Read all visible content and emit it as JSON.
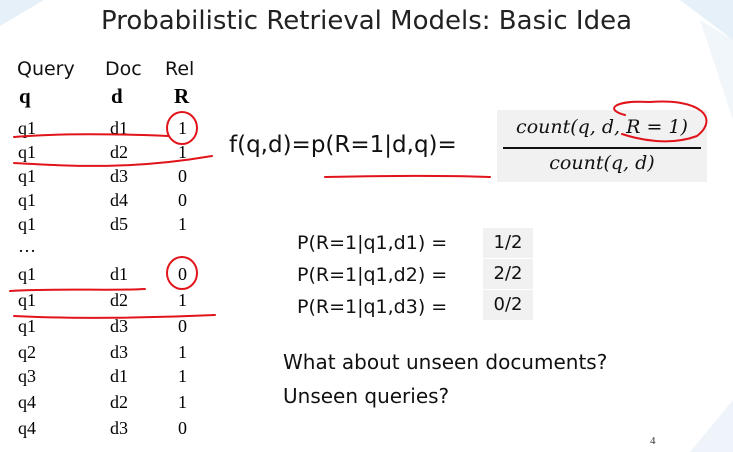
{
  "slide": {
    "title": "Probabilistic Retrieval Models: Basic Idea",
    "table": {
      "headers": [
        "Query",
        "Doc",
        "Rel"
      ],
      "symbols": [
        "q",
        "d",
        "R"
      ],
      "rows": [
        [
          "q1",
          "d1",
          "1"
        ],
        [
          "q1",
          "d2",
          "1"
        ],
        [
          "q1",
          "d3",
          "0"
        ],
        [
          "q1",
          "d4",
          "0"
        ],
        [
          "q1",
          "d5",
          "1"
        ],
        [
          "…",
          "",
          ""
        ],
        [
          "q1",
          "d1",
          "0"
        ],
        [
          "q1",
          "d2",
          "1"
        ],
        [
          "q1",
          "d3",
          "0"
        ],
        [
          "q2",
          "d3",
          "1"
        ],
        [
          "q3",
          "d1",
          "1"
        ],
        [
          "q4",
          "d2",
          "1"
        ],
        [
          "q4",
          "d3",
          "0"
        ]
      ]
    },
    "formula": {
      "lhs": "f(q,d)=p(R=1|d,q)=",
      "numerator": "count(q, d, R = 1)",
      "denominator": "count(q, d)"
    },
    "probabilities": [
      {
        "label": "P(R=1|q1,d1)  =",
        "value": "1/2"
      },
      {
        "label": "P(R=1|q1,d2)  =",
        "value": "2/2"
      },
      {
        "label": "P(R=1|q1,d3)  =",
        "value": "0/2"
      }
    ],
    "questions": [
      "What about unseen documents?",
      "Unseen queries?"
    ],
    "page_number": "4",
    "annotation_color": "#e0141a"
  }
}
